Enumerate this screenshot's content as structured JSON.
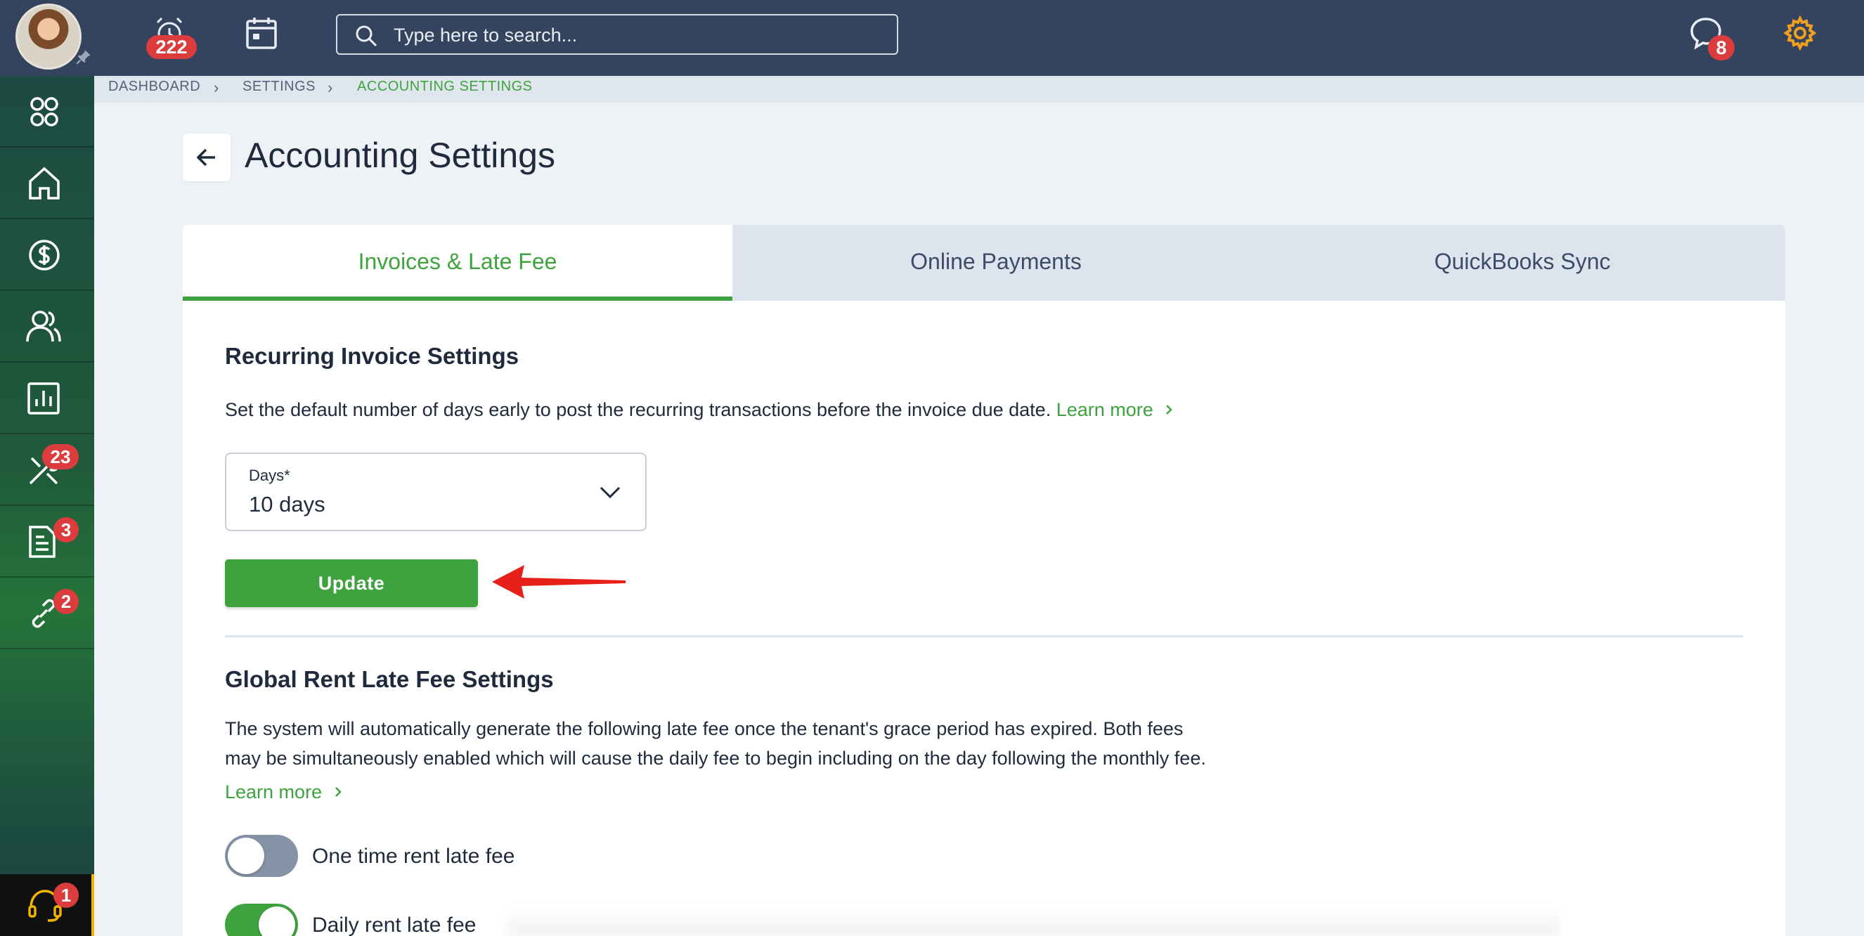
{
  "topbar": {
    "alarm_badge": "222",
    "search_placeholder": "Type here to search...",
    "messages_badge": "8"
  },
  "sidebar": {
    "items": [
      {
        "name": "apps",
        "badge": ""
      },
      {
        "name": "home",
        "badge": ""
      },
      {
        "name": "accounting",
        "badge": ""
      },
      {
        "name": "people",
        "badge": ""
      },
      {
        "name": "reports",
        "badge": ""
      },
      {
        "name": "maintenance",
        "badge": "23"
      },
      {
        "name": "documents",
        "badge": "3"
      },
      {
        "name": "links",
        "badge": "2"
      }
    ],
    "support_badge": "1"
  },
  "breadcrumb": [
    "DASHBOARD",
    "SETTINGS",
    "ACCOUNTING SETTINGS"
  ],
  "page": {
    "title": "Accounting Settings"
  },
  "tabs": [
    "Invoices & Late Fee",
    "Online Payments",
    "QuickBooks Sync"
  ],
  "recurring": {
    "heading": "Recurring Invoice Settings",
    "description": "Set the default number of days early to post the recurring transactions before the invoice due date.",
    "learn_more": "Learn more",
    "days_label": "Days*",
    "days_value": "10 days",
    "update_label": "Update"
  },
  "late_fee": {
    "heading": "Global Rent Late Fee Settings",
    "description_line1": "The system will automatically generate the following late fee once the tenant's grace period has expired. Both fees",
    "description_line2": "may be simultaneously enabled which will cause the daily fee to begin including on the day following the monthly fee.",
    "learn_more": "Learn more",
    "toggles": [
      {
        "label": "One time rent late fee",
        "enabled": false
      },
      {
        "label": "Daily rent late fee",
        "enabled": true
      }
    ]
  },
  "colors": {
    "accent": "#3ea33e",
    "topbar": "#34445e",
    "badge": "#dc3c3c",
    "annotation_arrow": "#e8201a"
  }
}
